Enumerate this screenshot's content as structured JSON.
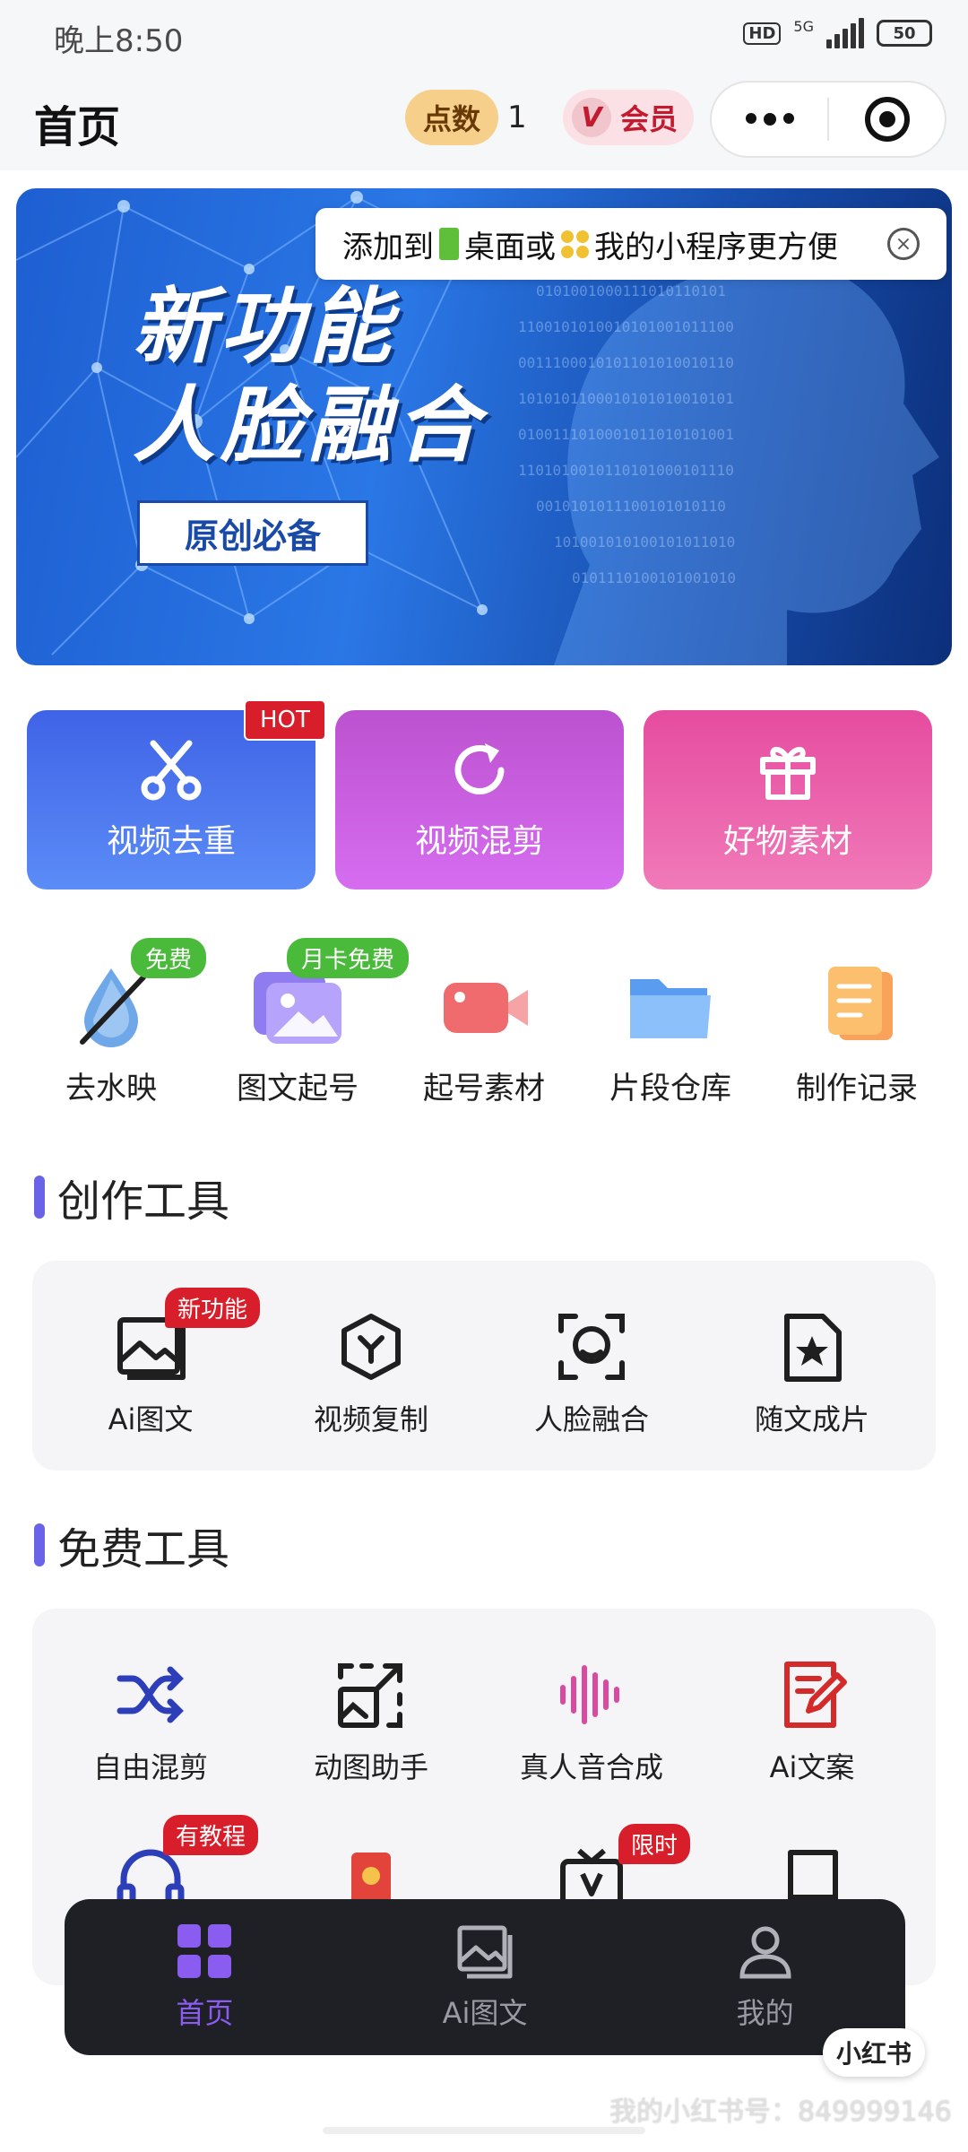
{
  "status": {
    "time": "晚上8:50",
    "hd": "HD",
    "network": "5G",
    "battery": "50"
  },
  "header": {
    "title": "首页",
    "points_label": "点数",
    "points_value": "1",
    "vip_mark": "V",
    "vip_label": "会员"
  },
  "banner": {
    "line1": "新功能",
    "line2": "人脸融合",
    "tag": "原创必备"
  },
  "tip": {
    "part1": "添加到",
    "part2": "桌面或",
    "part3": "我的小程序更方便",
    "close": "×"
  },
  "big_buttons": [
    {
      "label": "视频去重",
      "icon": "scissors-icon"
    },
    {
      "label": "视频混剪",
      "icon": "refresh-icon"
    },
    {
      "label": "好物素材",
      "icon": "gift-icon"
    }
  ],
  "hot_badge": "HOT",
  "quick_items": [
    {
      "label": "去水映",
      "badge": "免费",
      "icon": "water-drop-icon"
    },
    {
      "label": "图文起号",
      "badge": "月卡免费",
      "icon": "photo-icon"
    },
    {
      "label": "起号素材",
      "badge": "",
      "icon": "video-camera-icon"
    },
    {
      "label": "片段仓库",
      "badge": "",
      "icon": "folder-icon"
    },
    {
      "label": "制作记录",
      "badge": "",
      "icon": "document-icon"
    }
  ],
  "creation_tools": {
    "title": "创作工具",
    "items": [
      {
        "label": "Ai图文",
        "badge": "新功能",
        "icon": "image-icon"
      },
      {
        "label": "视频复制",
        "badge": "",
        "icon": "hexagon-y-icon"
      },
      {
        "label": "人脸融合",
        "badge": "",
        "icon": "face-scan-icon"
      },
      {
        "label": "随文成片",
        "badge": "",
        "icon": "star-file-icon"
      }
    ]
  },
  "free_tools": {
    "title": "免费工具",
    "items": [
      {
        "label": "自由混剪",
        "badge": "",
        "icon": "shuffle-icon"
      },
      {
        "label": "动图助手",
        "badge": "",
        "icon": "resize-image-icon"
      },
      {
        "label": "真人音合成",
        "badge": "",
        "icon": "waveform-icon"
      },
      {
        "label": "Ai文案",
        "badge": "",
        "icon": "edit-file-icon"
      }
    ],
    "row2_badges": [
      "有教程",
      "限时"
    ]
  },
  "tabbar": [
    {
      "label": "首页",
      "icon": "grid-icon",
      "active": true
    },
    {
      "label": "Ai图文",
      "icon": "image-icon",
      "active": false
    },
    {
      "label": "我的",
      "icon": "user-icon",
      "active": false
    }
  ],
  "corner_logo": "小红书",
  "watermark": "我的小红书号：849999146",
  "colors": {
    "accent": "#8b5cf0",
    "badge_red": "#d81e2a",
    "badge_green": "#4aba3a",
    "tabbar_bg": "#1f1f26"
  }
}
